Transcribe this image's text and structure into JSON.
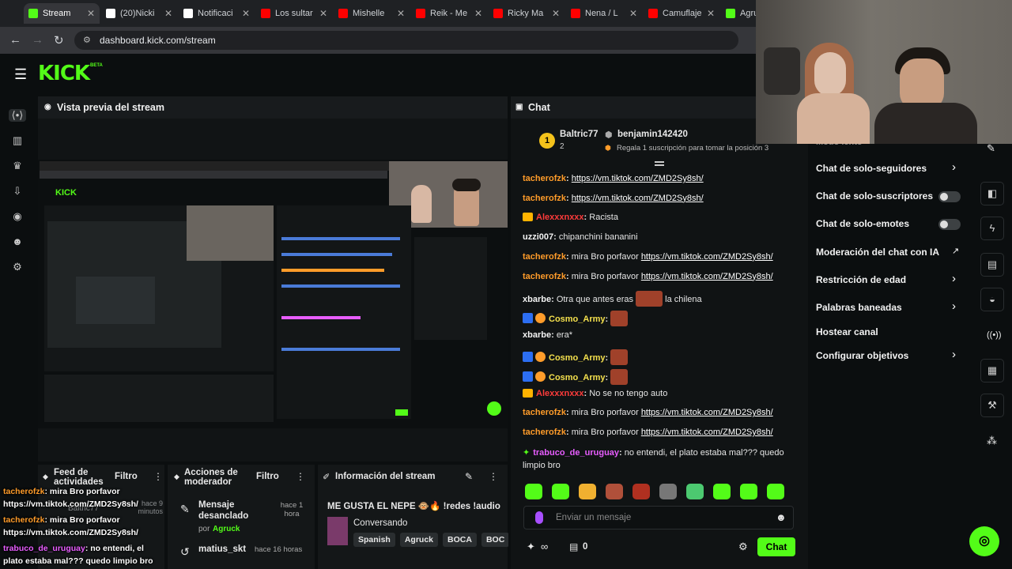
{
  "browser": {
    "tabs": [
      {
        "label": "Stream",
        "active": true,
        "color": "#53fc18"
      },
      {
        "label": "(20)Nicki",
        "color": "#ffffff"
      },
      {
        "label": "Notificaci",
        "color": "#ffffff"
      },
      {
        "label": "Los sultar",
        "color": "#ff0000"
      },
      {
        "label": "Mishelle",
        "color": "#ff0000"
      },
      {
        "label": "Reik - Me",
        "color": "#ff0000"
      },
      {
        "label": "Ricky Ma",
        "color": "#ff0000"
      },
      {
        "label": "Nena / L",
        "color": "#ff0000"
      },
      {
        "label": "Camuflaje",
        "color": "#ff0000"
      },
      {
        "label": "Agru",
        "color": "#53fc18"
      }
    ],
    "url": "dashboard.kick.com/stream"
  },
  "header": {
    "logo": "KICK",
    "beta": "BETA"
  },
  "preview": {
    "title": "Vista previa del stream"
  },
  "chat": {
    "title": "Chat",
    "top_gifter": {
      "rank": "1",
      "name": "Baltric77",
      "count": "2",
      "second": "benjamin142420",
      "cta": "Regala 1 suscripción para tomar la posición 3"
    },
    "messages": [
      {
        "user": "tacherofzk",
        "text": "",
        "link": "https://vm.tiktok.com/ZMD2Sy8sh/"
      },
      {
        "user": "tacherofzk",
        "text": "",
        "link": "https://vm.tiktok.com/ZMD2Sy8sh/"
      },
      {
        "user": "Alexxxnxxx",
        "text": "Racista"
      },
      {
        "user": "uzzi007",
        "text": "chipanchini bananini"
      },
      {
        "user": "tacherofzk",
        "text": "mira Bro porfavor",
        "link": "https://vm.tiktok.com/ZMD2Sy8sh/"
      },
      {
        "user": "tacherofzk",
        "text": "mira Bro porfavor",
        "link": "https://vm.tiktok.com/ZMD2Sy8sh/"
      },
      {
        "user": "xbarbe",
        "text": "Otra que antes eras",
        "text2": "la chilena"
      },
      {
        "user": "Cosmo_Army",
        "text": ""
      },
      {
        "user": "xbarbe",
        "text": "era*"
      },
      {
        "user": "Cosmo_Army",
        "text": ""
      },
      {
        "user": "Cosmo_Army",
        "text": ""
      },
      {
        "user": "Alexxxnxxx",
        "text": "No se no tengo auto"
      },
      {
        "user": "tacherofzk",
        "text": "mira Bro porfavor",
        "link": "https://vm.tiktok.com/ZMD2Sy8sh/"
      },
      {
        "user": "tacherofzk",
        "text": "mira Bro porfavor",
        "link": "https://vm.tiktok.com/ZMD2Sy8sh/"
      },
      {
        "user": "trabuco_de_uruguay",
        "text": "no entendi, el plato estaba mal??? quedo",
        "text2": "limpio bro"
      }
    ],
    "input_placeholder": "Enviar un mensaje",
    "counter_a": "∞",
    "counter_b": "0",
    "send_label": "Chat"
  },
  "settings": {
    "partial": "Modo lento",
    "items": [
      {
        "label": "Chat de solo-seguidores",
        "control": "chevron"
      },
      {
        "label": "Chat de solo-suscriptores",
        "control": "toggle"
      },
      {
        "label": "Chat de solo-emotes",
        "control": "toggle"
      },
      {
        "label": "Moderación del chat con IA",
        "control": "external"
      },
      {
        "label": "Restricción de edad",
        "control": "chevron"
      },
      {
        "label": "Palabras baneadas",
        "control": "chevron"
      },
      {
        "label": "Hostear canal",
        "control": "none"
      },
      {
        "label": "Configurar objetivos",
        "control": "chevron"
      }
    ]
  },
  "feed": {
    "title": "Feed de actividades",
    "filter": "Filtro",
    "item": "Baltric77",
    "time": "hace 9 minutos"
  },
  "mod": {
    "title": "Acciones de moderador",
    "filter": "Filtro",
    "items": [
      {
        "text": "Mensaje desanclado",
        "by": "por",
        "who": "Agruck",
        "time": "hace 1 hora"
      },
      {
        "text": "matius_skt",
        "time": "hace 16 horas"
      }
    ]
  },
  "info": {
    "title": "Información del stream",
    "stream_title": "ME GUSTA EL NEPE 🐵🔥 !redes !audio",
    "category": "Conversando",
    "tags": [
      "Spanish",
      "Agruck",
      "BOCA",
      "BOC"
    ]
  },
  "overlay": {
    "lines": [
      {
        "user": "tacherofzk",
        "text": ": mira Bro porfavor"
      },
      {
        "user": "",
        "text": "https://vm.tiktok.com/ZMD2Sy8sh/"
      },
      {
        "user": "tacherofzk",
        "text": ": mira Bro porfavor"
      },
      {
        "user": "",
        "text": "https://vm.tiktok.com/ZMD2Sy8sh/"
      },
      {
        "user": "trabuco_de_uruguay",
        "text": ": no entendi, el"
      },
      {
        "user": "",
        "text": "plato estaba mal??? quedo limpio bro"
      }
    ]
  }
}
